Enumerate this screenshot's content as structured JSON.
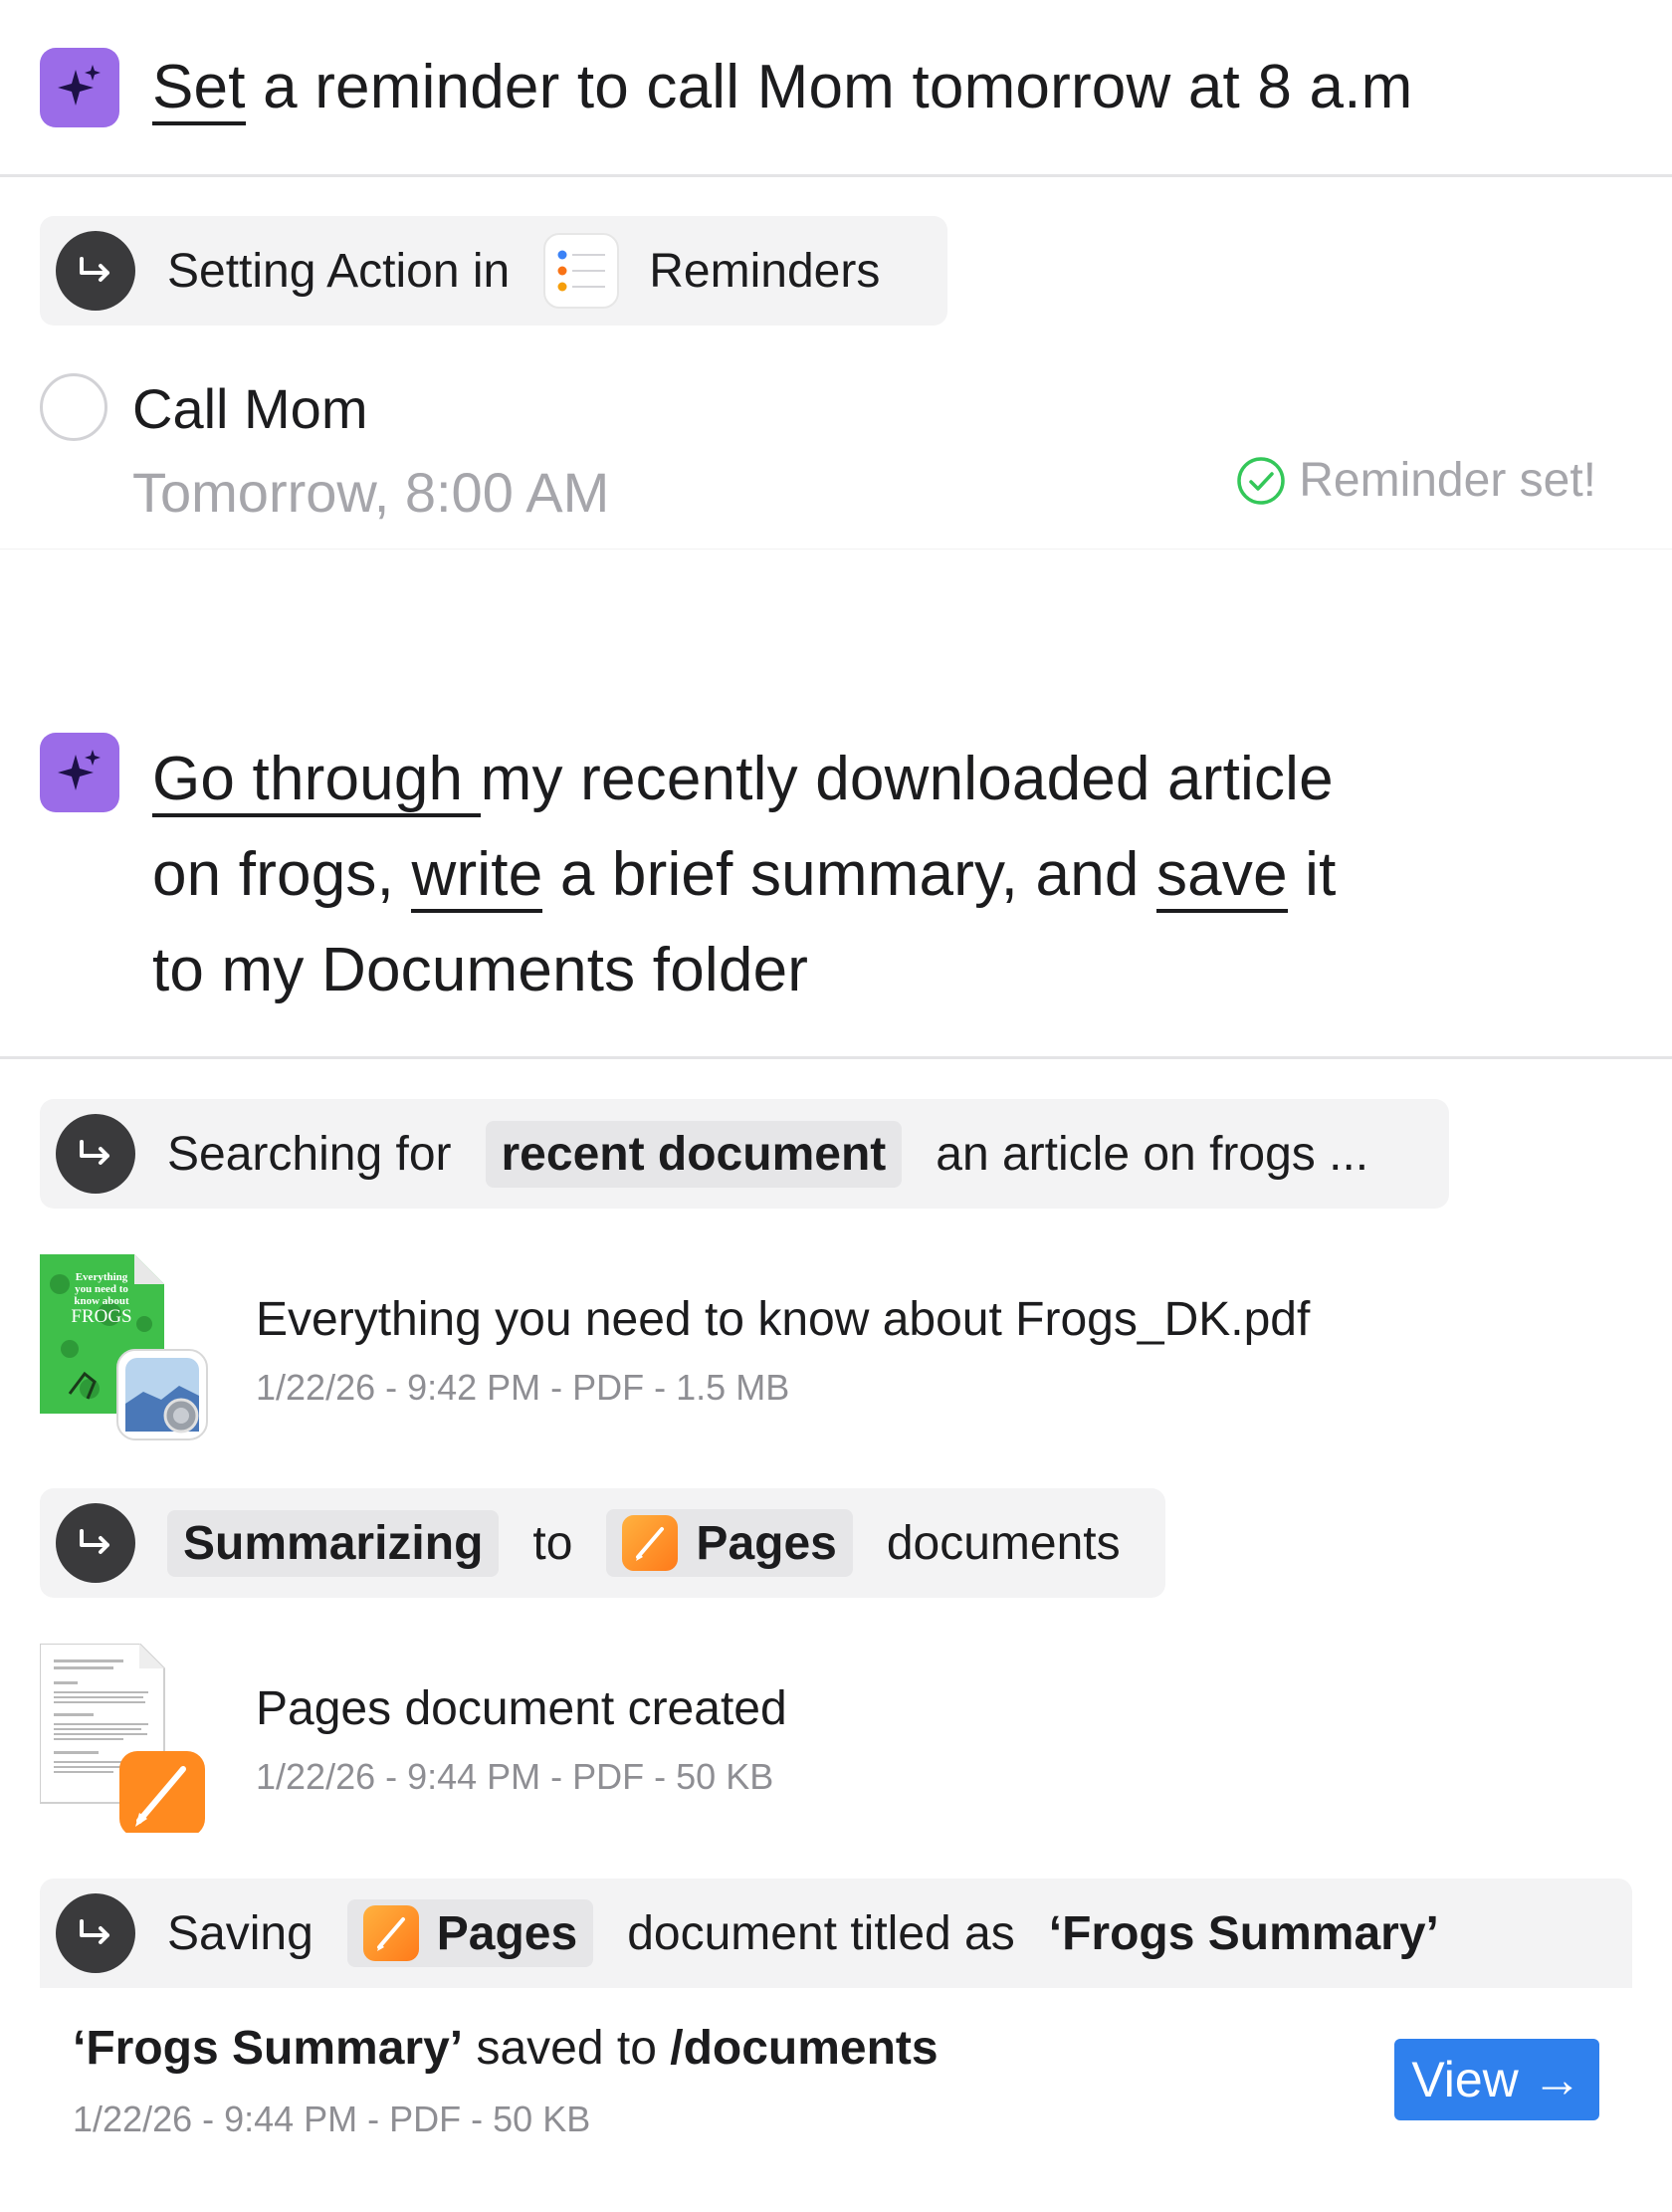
{
  "prompt1": {
    "word1": "Set",
    "rest": " a reminder to call Mom tomorrow at 8 a.m"
  },
  "action1": {
    "prefix": "Setting Action in",
    "app": "Reminders",
    "app_icon": "reminders-app-icon"
  },
  "task": {
    "title": "Call Mom",
    "time": "Tomorrow, 8:00 AM",
    "status": "Reminder set!"
  },
  "prompt2": {
    "w1": "Go through ",
    "t1": "my recently downloaded article",
    "t2a": "on frogs, ",
    "w2": "write",
    "t2b": " a brief summary, and ",
    "w3": "save",
    "t2c": " it",
    "t3": "to my Documents folder"
  },
  "action2": {
    "prefix": "Searching for",
    "chip": "recent document",
    "suffix": "an article on frogs ..."
  },
  "file1": {
    "name": "Everything you need to know about Frogs_DK.pdf",
    "meta": "1/22/26 - 9:42 PM - PDF - 1.5 MB",
    "cover_title": "Everything you need to know about FROGS"
  },
  "action3": {
    "chip": "Summarizing",
    "to": "to",
    "app": "Pages",
    "suffix": "documents"
  },
  "file2": {
    "name": "Pages document created",
    "meta": "1/22/26 - 9:44 PM - PDF - 50 KB"
  },
  "action4": {
    "prefix": "Saving",
    "app": "Pages",
    "middle": "document titled as",
    "title": "‘Frogs Summary’"
  },
  "saved": {
    "name": "‘Frogs Summary’",
    "middle": " saved to ",
    "path": "/documents",
    "meta": "1/22/26 - 9:44 PM - PDF - 50 KB",
    "button": "View →"
  },
  "colors": {
    "accent": "#2f80ed",
    "ai_icon": "#9b6ce8",
    "success": "#34c759",
    "pages": "#ff8a1f"
  }
}
